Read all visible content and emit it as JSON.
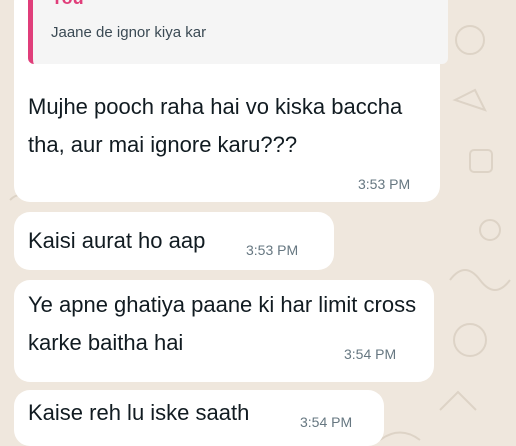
{
  "quoted_reply": {
    "author": "You",
    "text": "Jaane de ignor kiya kar"
  },
  "messages": [
    {
      "text": "Mujhe pooch raha hai vo kiska baccha tha, aur mai ignore karu???",
      "time": "3:53 PM"
    },
    {
      "text": "Kaisi aurat ho aap",
      "time": "3:53 PM"
    },
    {
      "text": "Ye apne ghatiya paane ki har limit cross karke baitha hai",
      "time": "3:54 PM"
    },
    {
      "text": "Kaise reh lu iske saath",
      "time": "3:54 PM"
    }
  ]
}
